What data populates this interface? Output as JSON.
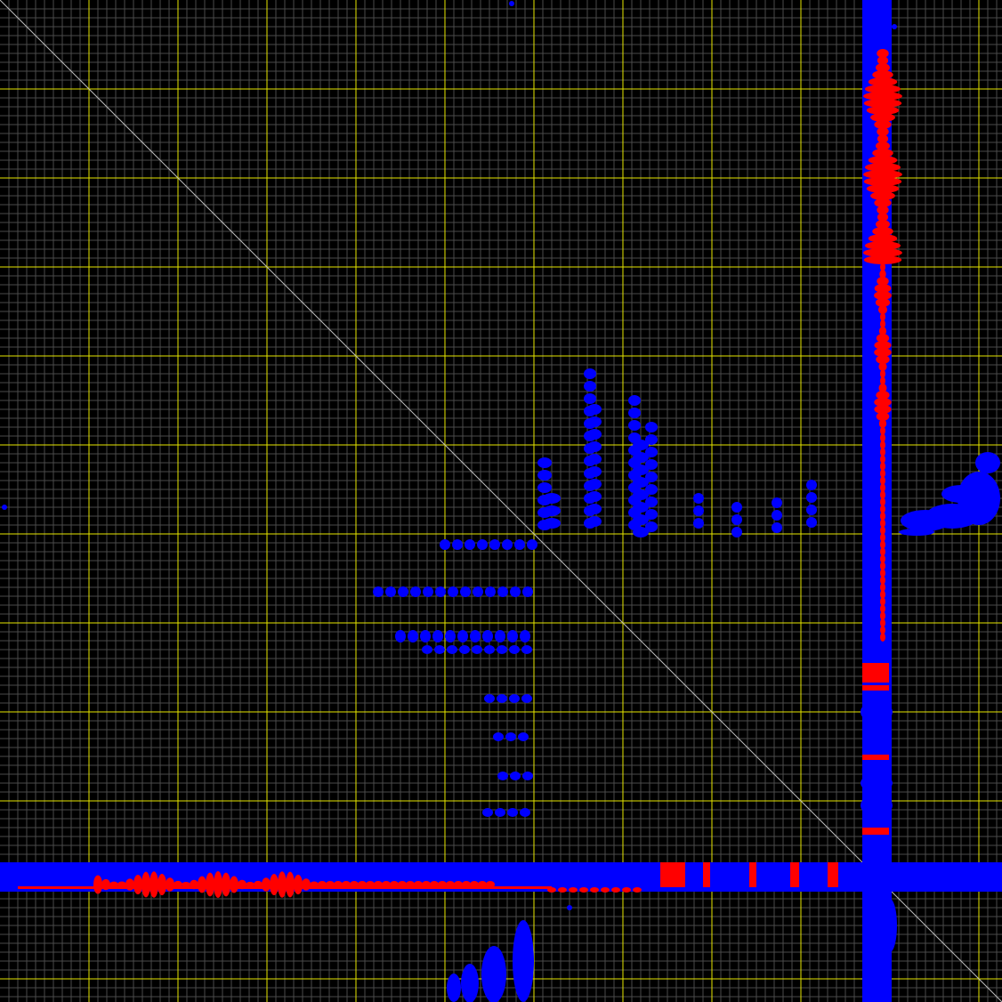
{
  "viewer": {
    "name": "contact-map-viewer"
  },
  "colors": {
    "background": "#000000",
    "minor_grid": "#4a4a4a",
    "major_grid": "#e6e600",
    "diagonal": "#bdbdbd",
    "primary_signal": "#0000ff",
    "secondary_signal": "#ff0000"
  }
}
